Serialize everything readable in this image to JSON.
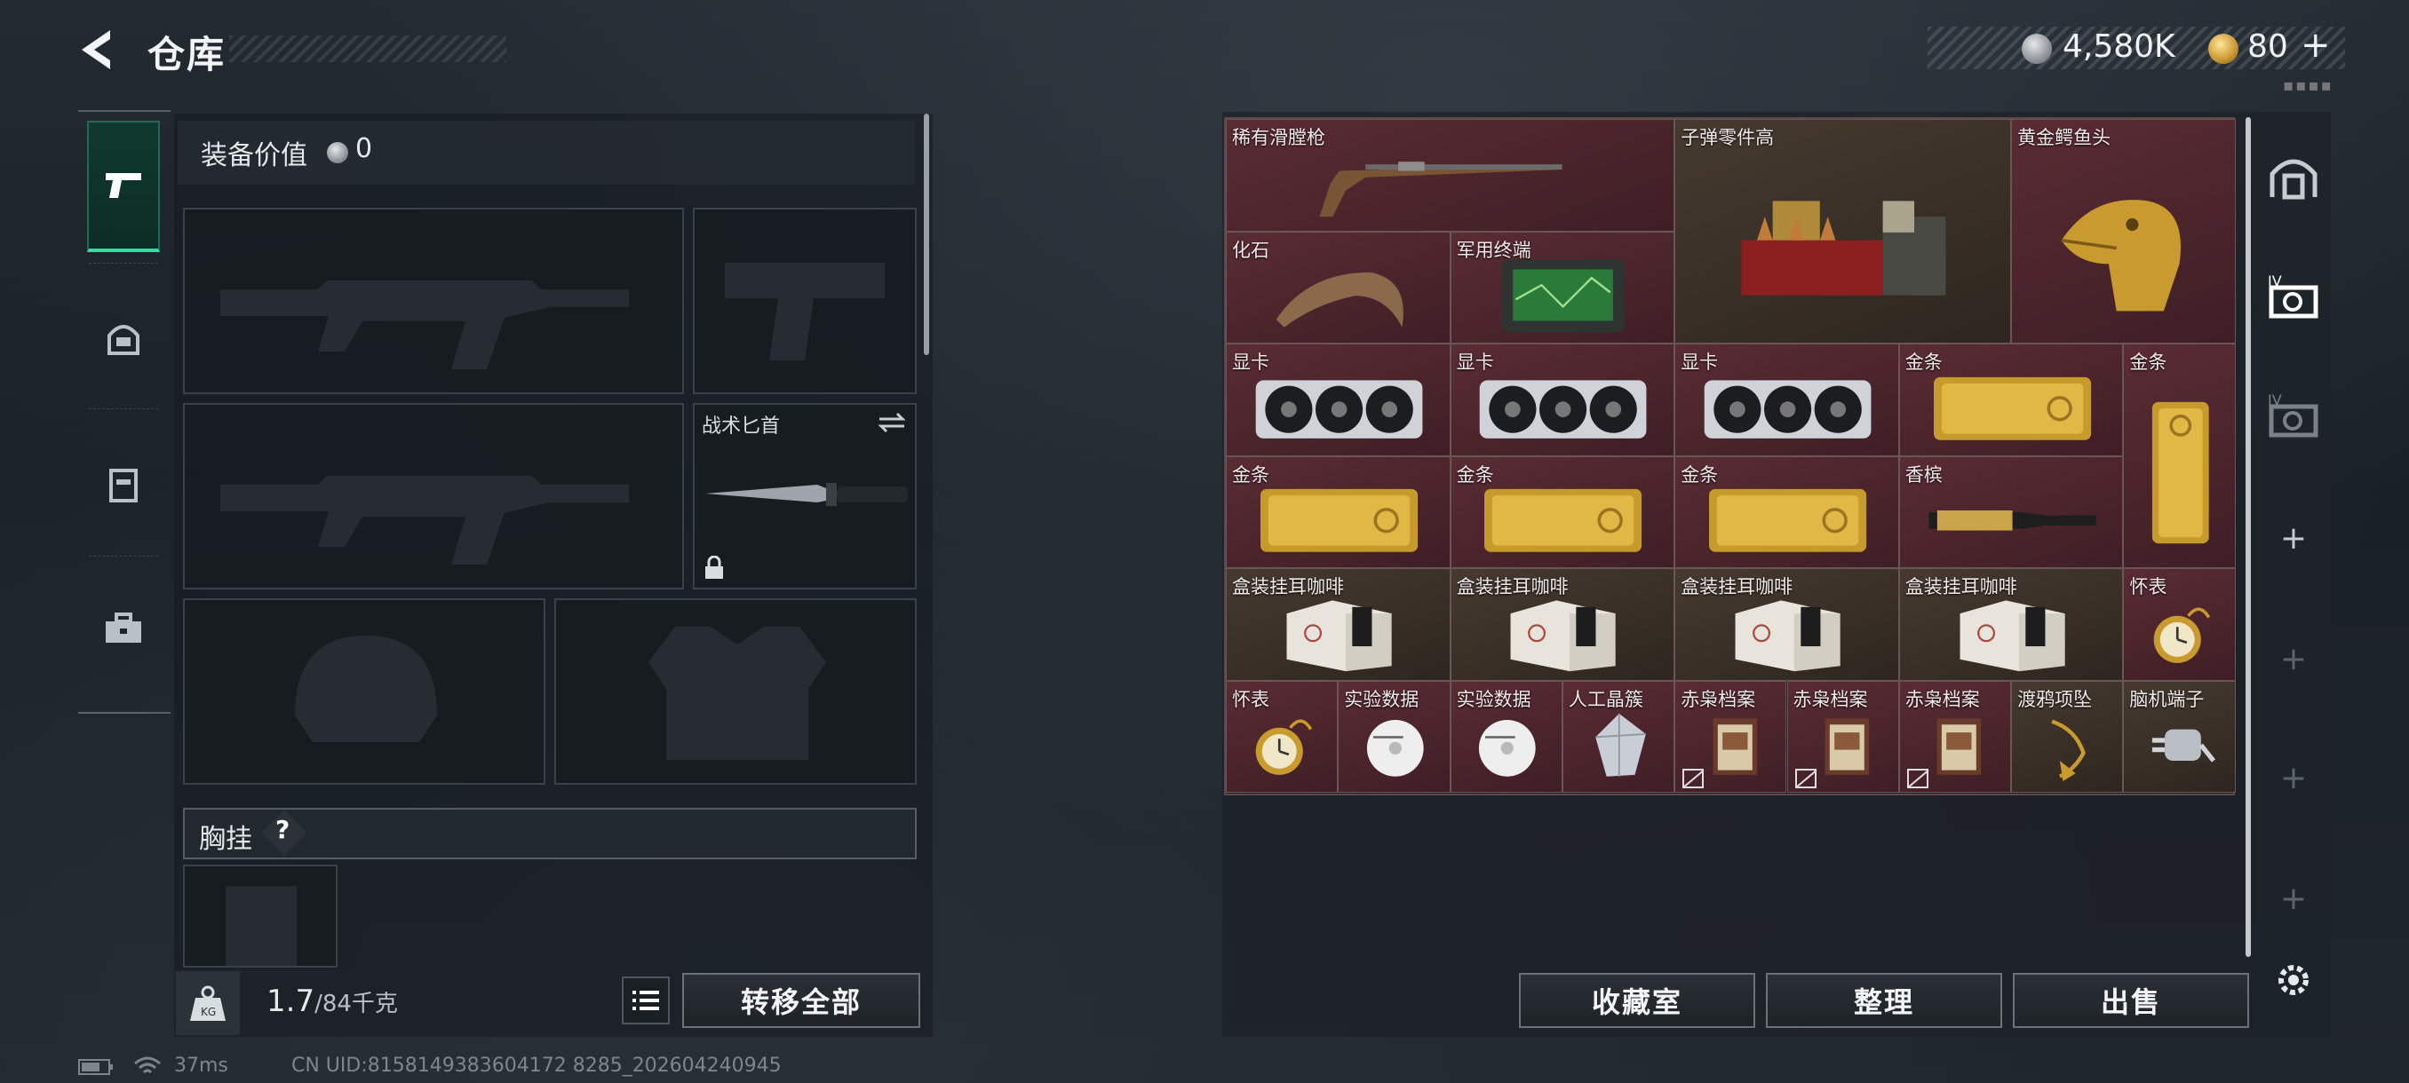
{
  "header": {
    "title": "仓库"
  },
  "currency": {
    "silver": "4,580K",
    "gold": "80"
  },
  "equipment": {
    "value_label": "装备价值",
    "value": "0",
    "knife_label": "战术匕首",
    "chest_label": "胸挂",
    "help": "?"
  },
  "weight": {
    "current": "1.7",
    "max": "/84千克"
  },
  "buttons": {
    "transfer_all": "转移全部",
    "collection": "收藏室",
    "organize": "整理",
    "sell": "出售"
  },
  "status": {
    "ping": "37ms",
    "uid": "CN UID:8158149383604172 8285_202604240945"
  },
  "inventory": {
    "items": [
      {
        "name": "稀有滑膛枪",
        "art": "musket"
      },
      {
        "name": "子弹零件高",
        "art": "ammo"
      },
      {
        "name": "黄金鳄鱼头",
        "art": "croc"
      },
      {
        "name": "化石",
        "art": "claw"
      },
      {
        "name": "军用终端",
        "art": "terminal"
      },
      {
        "name": "显卡",
        "art": "gpu"
      },
      {
        "name": "显卡",
        "art": "gpu"
      },
      {
        "name": "显卡",
        "art": "gpu"
      },
      {
        "name": "金条",
        "art": "gold"
      },
      {
        "name": "金条",
        "art": "goldv"
      },
      {
        "name": "金条",
        "art": "gold"
      },
      {
        "name": "金条",
        "art": "gold"
      },
      {
        "name": "金条",
        "art": "gold"
      },
      {
        "name": "香槟",
        "art": "champagne"
      },
      {
        "name": "盒装挂耳咖啡",
        "art": "coffee"
      },
      {
        "name": "盒装挂耳咖啡",
        "art": "coffee"
      },
      {
        "name": "盒装挂耳咖啡",
        "art": "coffee"
      },
      {
        "name": "盒装挂耳咖啡",
        "art": "coffee"
      },
      {
        "name": "怀表",
        "art": "watch"
      },
      {
        "name": "怀表",
        "art": "watch"
      },
      {
        "name": "实验数据",
        "art": "disc"
      },
      {
        "name": "实验数据",
        "art": "disc"
      },
      {
        "name": "人工晶簇",
        "art": "crystal"
      },
      {
        "name": "赤枭档案",
        "art": "file"
      },
      {
        "name": "赤枭档案",
        "art": "file"
      },
      {
        "name": "赤枭档案",
        "art": "file"
      },
      {
        "name": "渡鸦项坠",
        "art": "pendant"
      },
      {
        "name": "脑机端子",
        "art": "plug"
      }
    ]
  }
}
